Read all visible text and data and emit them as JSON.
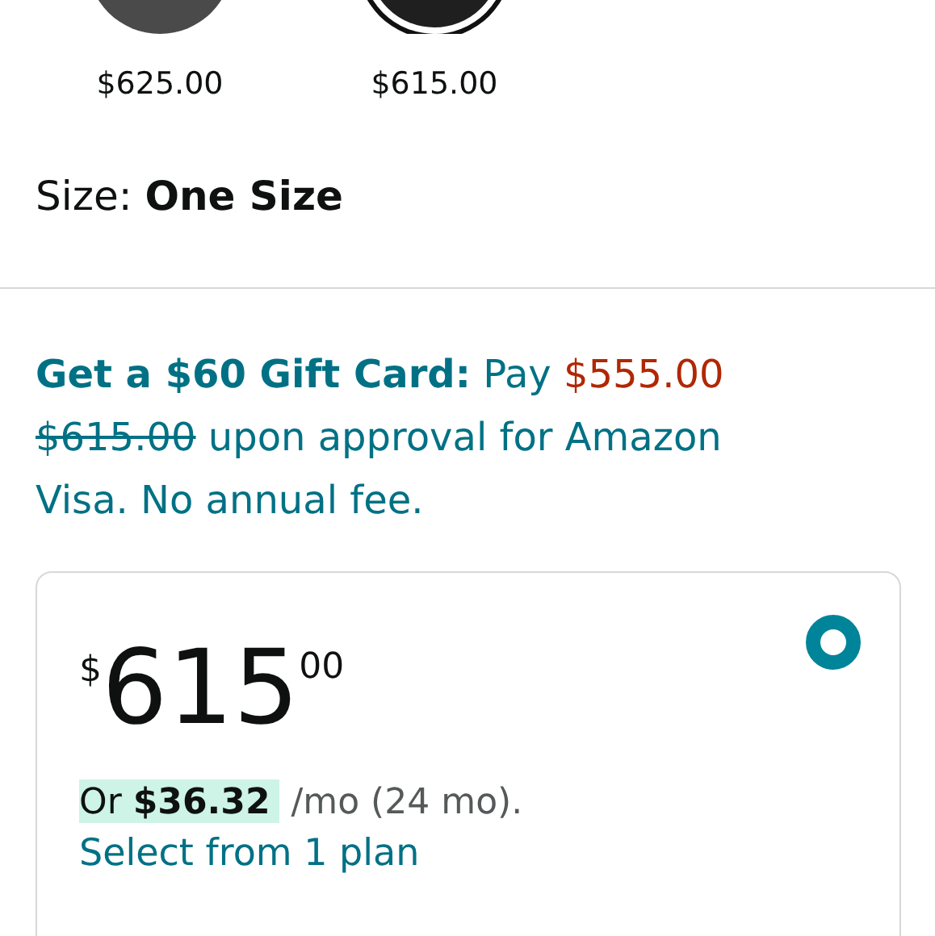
{
  "swatches": [
    {
      "price": "$625.00",
      "color": "#4a4a4a",
      "selected": false
    },
    {
      "price": "$615.00",
      "color": "#1f1f1f",
      "selected": true
    }
  ],
  "size": {
    "label": "Size:",
    "value": "One Size"
  },
  "offer": [
    {
      "kind": "bold",
      "text": "Get a $60 Gift Card:"
    },
    {
      "kind": "plain",
      "text": " Pay "
    },
    {
      "kind": "price",
      "text": "$555.00"
    },
    {
      "kind": "struck",
      "text": "$615.00"
    },
    {
      "kind": "plain",
      "text": " upon approval for Amazon Visa. No annual fee."
    }
  ],
  "option": {
    "selected": true,
    "currency": "$",
    "whole": "615",
    "fraction": "00",
    "monthly": "Or **$36.32**",
    "term": "/mo (24 mo).",
    "link": "Select from 1 plan"
  }
}
